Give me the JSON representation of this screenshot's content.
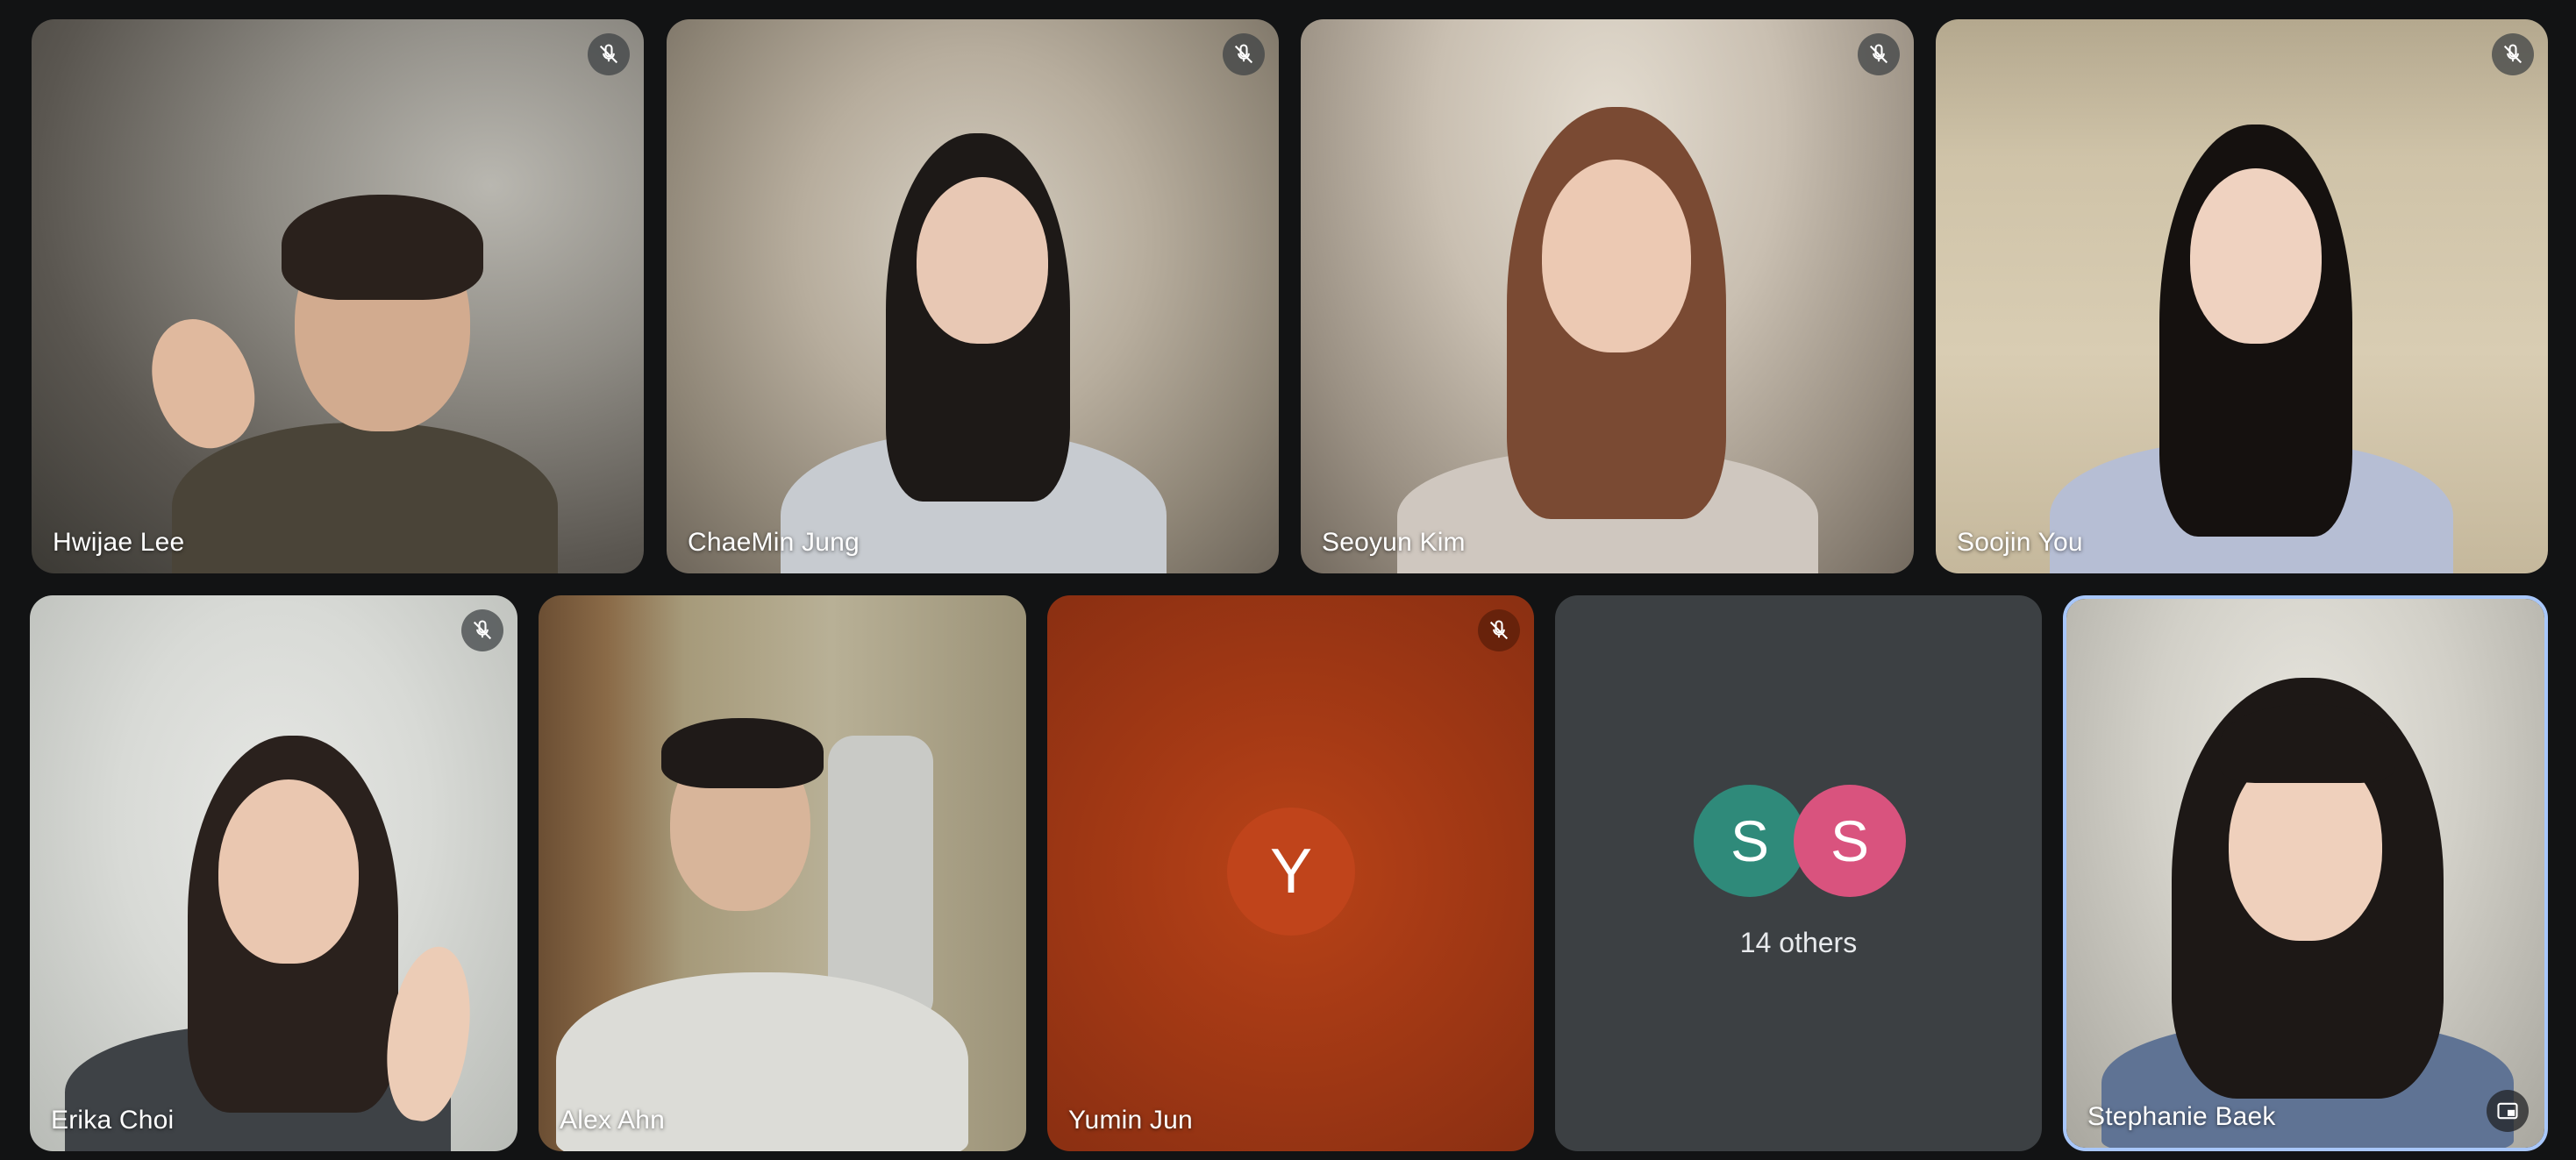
{
  "colors": {
    "background": "#121314",
    "others_tile": "#3c4043",
    "active_border": "#a8c7fa",
    "yumin_tile": "#a23a17",
    "yumin_avatar": "#b8401c",
    "avatar_s1": "#2f8a7a",
    "avatar_s2": "#d9537e"
  },
  "participants": [
    {
      "name": "Hwijae Lee",
      "muted": true,
      "video": true
    },
    {
      "name": "ChaeMin Jung",
      "muted": true,
      "video": true
    },
    {
      "name": "Seoyun Kim",
      "muted": true,
      "video": true
    },
    {
      "name": "Soojin You",
      "muted": true,
      "video": true
    },
    {
      "name": "Erika Choi",
      "muted": true,
      "video": true
    },
    {
      "name": "Alex Ahn",
      "muted": false,
      "video": true
    },
    {
      "name": "Yumin Jun",
      "muted": true,
      "video": false,
      "avatar_letter": "Y"
    },
    {
      "name": "Stephanie Baek",
      "muted": false,
      "video": true,
      "self": true
    }
  ],
  "others": {
    "avatars": [
      "S",
      "S"
    ],
    "label": "14 others"
  },
  "icons": {
    "mute": "mic-off-icon",
    "pip": "picture-in-picture-icon"
  }
}
